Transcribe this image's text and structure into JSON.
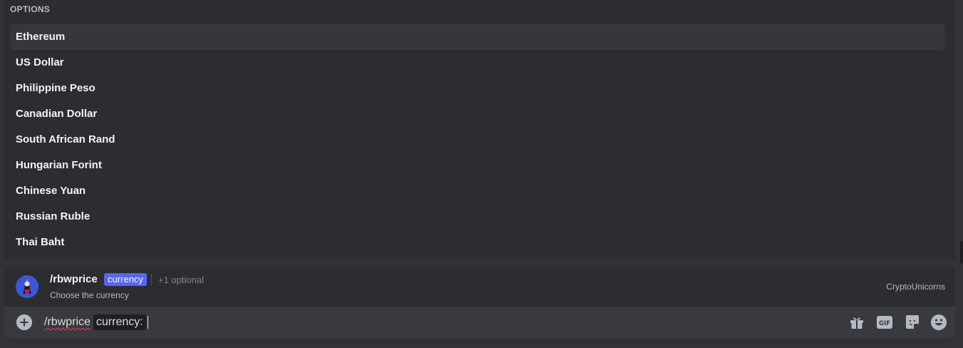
{
  "options": {
    "header": "OPTIONS",
    "items": [
      {
        "label": "Ethereum",
        "selected": true
      },
      {
        "label": "US Dollar"
      },
      {
        "label": "Philippine Peso"
      },
      {
        "label": "Canadian Dollar"
      },
      {
        "label": "South African Rand"
      },
      {
        "label": "Hungarian Forint"
      },
      {
        "label": "Chinese Yuan"
      },
      {
        "label": "Russian Ruble"
      },
      {
        "label": "Thai Baht"
      }
    ]
  },
  "command": {
    "name": "/rbwprice",
    "required_option": "currency",
    "optional_count": "+1 optional",
    "description": "Choose the currency",
    "app_name": "CryptoUnicorns"
  },
  "input": {
    "command_text": "/rbwprice",
    "option_chip": "currency:"
  },
  "icons": {
    "add": "plus-circle-icon",
    "gift": "gift-icon",
    "gif": "gif-icon",
    "sticker": "sticker-icon",
    "emoji": "emoji-icon"
  },
  "colors": {
    "accent": "#5865f2",
    "spellcheck": "#ed4245",
    "background": "#313338"
  }
}
